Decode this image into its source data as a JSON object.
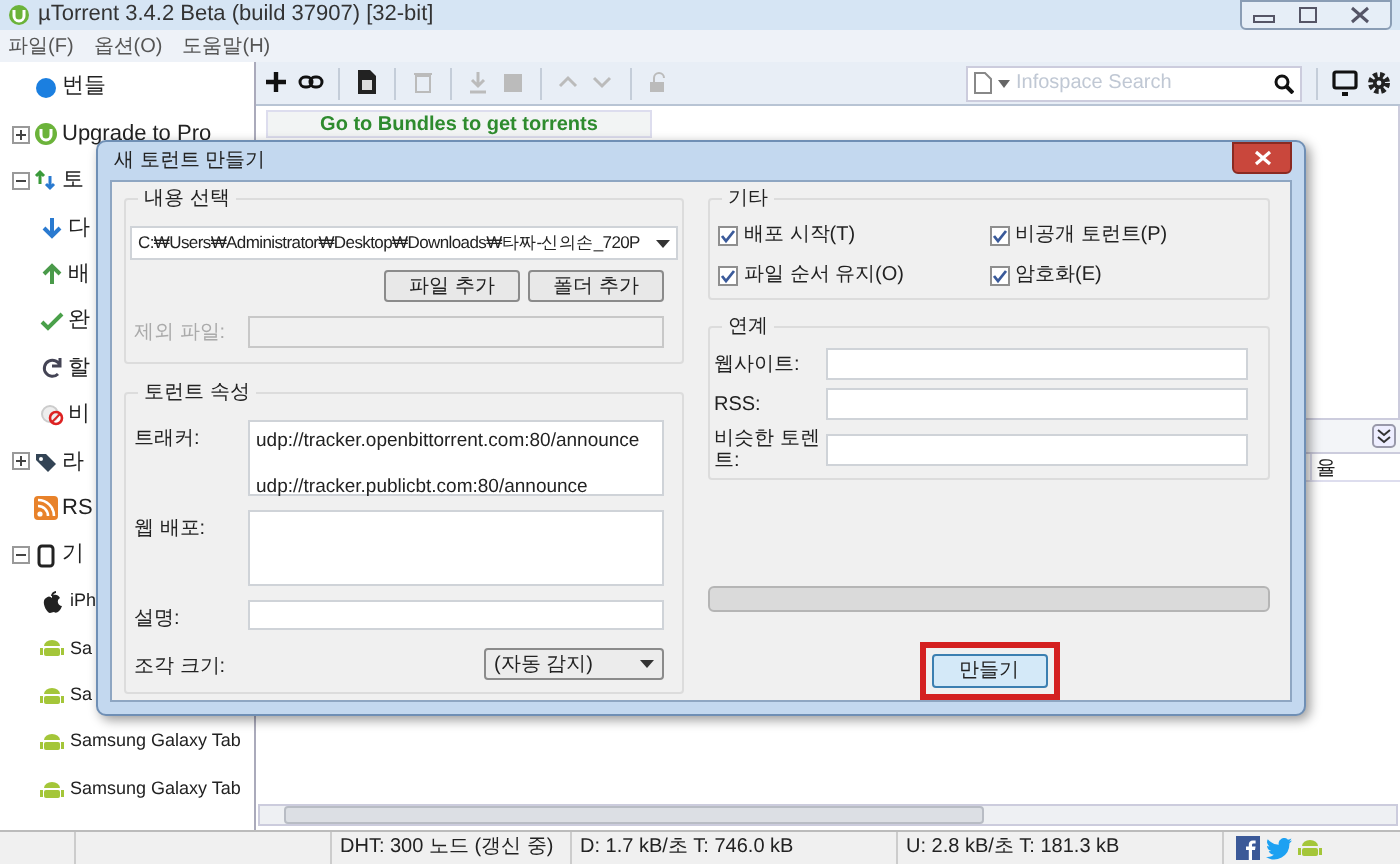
{
  "window": {
    "title": "µTorrent 3.4.2 Beta (build 37907) [32-bit]"
  },
  "menu": [
    "파일(F)",
    "옵션(O)",
    "도움말(H)"
  ],
  "sidebar": {
    "items": [
      {
        "kind": "bundle",
        "label": "번들"
      },
      {
        "kind": "upgrade",
        "label": "Upgrade to Pro",
        "expanded": false
      },
      {
        "kind": "torrents",
        "label": "토",
        "expanded": true,
        "children": [
          {
            "kind": "download",
            "label": "다"
          },
          {
            "kind": "upload",
            "label": "배"
          },
          {
            "kind": "done",
            "label": "완"
          },
          {
            "kind": "update",
            "label": "할"
          },
          {
            "kind": "inactive",
            "label": "비"
          }
        ]
      },
      {
        "kind": "labels",
        "label": "라",
        "expanded": false
      },
      {
        "kind": "rss",
        "label": "RS"
      },
      {
        "kind": "devices",
        "label": "기",
        "expanded": true,
        "children": [
          {
            "kind": "apple",
            "label": "iPh"
          },
          {
            "kind": "android",
            "label": "Sa"
          },
          {
            "kind": "android",
            "label": "Sa"
          },
          {
            "kind": "android",
            "label": "Samsung Galaxy Tab"
          },
          {
            "kind": "android",
            "label": "Samsung Galaxy Tab"
          }
        ]
      }
    ]
  },
  "search": {
    "placeholder": "Infospace Search"
  },
  "banner": "Go to Bundles to get torrents",
  "table": {
    "columns": [
      "율"
    ]
  },
  "status_bar": [
    "DHT: 300 노드 (갱신 중)",
    "D: 1.7 kB/초 T: 746.0 kB",
    "U: 2.8 kB/초 T: 181.3 kB"
  ],
  "dialog": {
    "title": "새 토런트 만들기",
    "source": {
      "heading": "내용 선택",
      "path": "C:₩Users₩Administrator₩Desktop₩Downloads₩타짜-신의손_720P",
      "buttons": [
        "파일 추가",
        "폴더 추가"
      ],
      "exclude": {
        "label": "제외 파일:",
        "disabled": true
      }
    },
    "properties": {
      "heading": "토런트 속성",
      "fields": [
        {
          "kind": "multiline",
          "label": "트래커:",
          "lines": [
            "udp://tracker.openbittorrent.com:80/announce",
            "udp://tracker.publicbt.com:80/announce"
          ]
        },
        {
          "kind": "multiline",
          "label": "웹 배포:"
        },
        {
          "kind": "text",
          "label": "설명:"
        },
        {
          "kind": "select",
          "label": "조각 크기:",
          "value": "(자동 감지)"
        }
      ]
    },
    "other": {
      "heading": "기타",
      "options": [
        {
          "label": "배포 시작(T)",
          "checked": true
        },
        {
          "label": "비공개 토런트(P)",
          "checked": true
        },
        {
          "label": "파일 순서 유지(O)",
          "checked": true
        },
        {
          "label": "암호화(E)",
          "checked": true
        }
      ]
    },
    "links": {
      "heading": "연계",
      "fields": [
        {
          "label": "웹사이트:"
        },
        {
          "label": "RSS:"
        },
        {
          "label": "비슷한 토렌트:"
        }
      ]
    },
    "progress": {
      "level": 0
    },
    "create_button": {
      "label": "만들기",
      "highlighted": true
    }
  }
}
